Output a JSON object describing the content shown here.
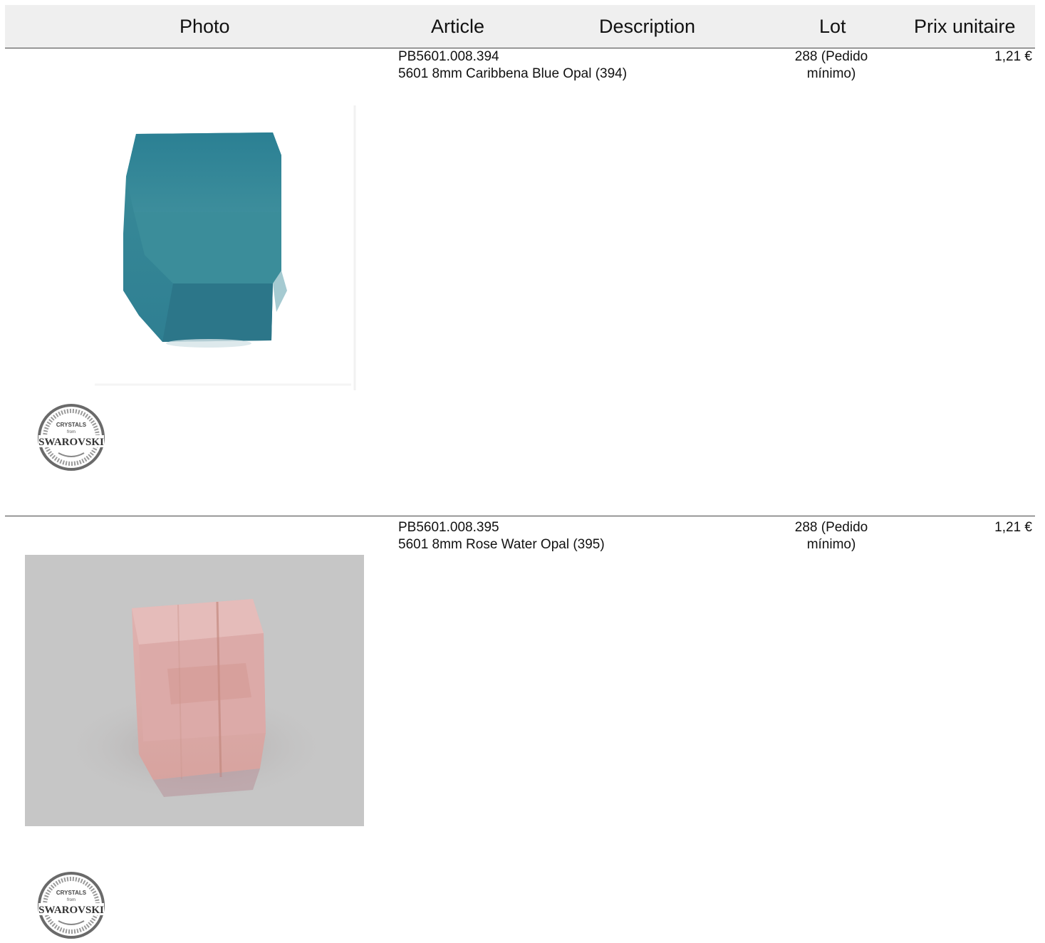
{
  "header": {
    "photo": "Photo",
    "article": "Article",
    "description": "Description",
    "lot": "Lot",
    "unit_price": "Prix unitaire"
  },
  "items": [
    {
      "reference": "PB5601.008.394",
      "description": "5601 8mm Caribbena Blue Opal (394)",
      "lot": "288 (Pedido mínimo)",
      "price": "1,21 €",
      "photo_color": "#2d7e91",
      "logo": {
        "top_text": "CRYSTALS",
        "mid_text": "from",
        "brand": "SWAROVSKI"
      }
    },
    {
      "reference": "PB5601.008.395",
      "description": "5601 8mm Rose Water Opal (395)",
      "lot": "288 (Pedido mínimo)",
      "price": "1,21 €",
      "photo_color": "#d8a7a7",
      "logo": {
        "top_text": "CRYSTALS",
        "mid_text": "from",
        "brand": "SWAROVSKI"
      }
    }
  ]
}
